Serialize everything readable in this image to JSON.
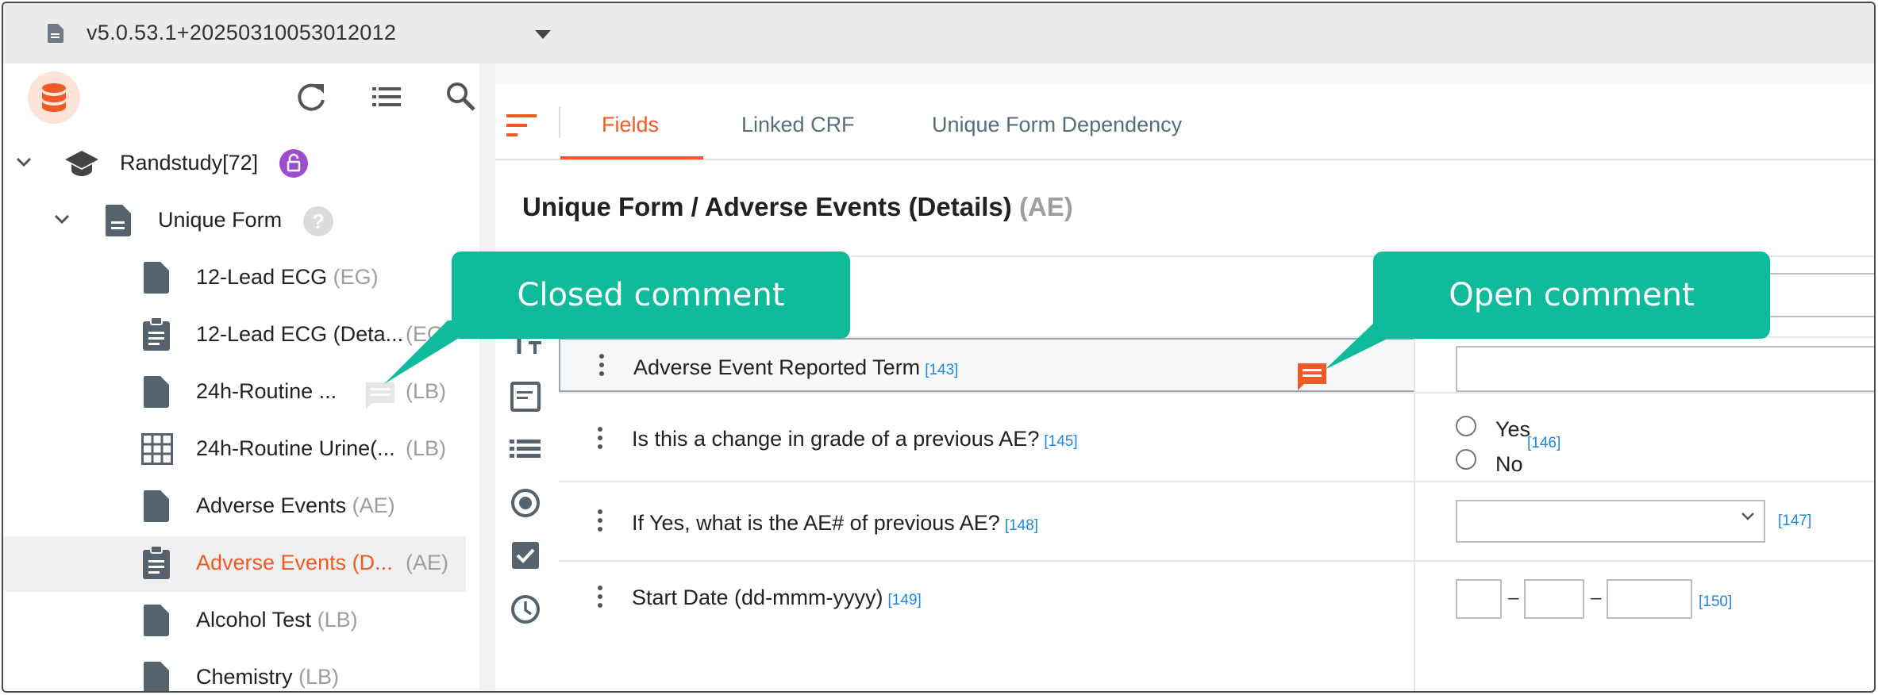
{
  "version_bar": {
    "version": "v5.0.53.1+20250310053012012"
  },
  "sidebar": {
    "study": {
      "label": "Randstudy[72]"
    },
    "group": {
      "label": "Unique Form"
    },
    "items": [
      {
        "label": "12-Lead ECG",
        "code": "(EG)"
      },
      {
        "label": "12-Lead ECG (Deta...",
        "code": "(EG)"
      },
      {
        "label": "24h-Routine ...",
        "code": "(LB)"
      },
      {
        "label": "24h-Routine Urine(...",
        "code": "(LB)"
      },
      {
        "label": "Adverse Events",
        "code": "(AE)"
      },
      {
        "label": "Adverse Events (D...",
        "code": "(AE)"
      },
      {
        "label": "Alcohol Test",
        "code": "(LB)"
      },
      {
        "label": "Chemistry",
        "code": "(LB)"
      }
    ]
  },
  "tabs": [
    {
      "label": "Fields"
    },
    {
      "label": "Linked CRF"
    },
    {
      "label": "Unique Form Dependency"
    }
  ],
  "page": {
    "title": "Unique Form / Adverse Events (Details)",
    "code": "(AE)"
  },
  "fields": [
    {
      "label": "Adverse Event Reported Term",
      "ref": "[143]"
    },
    {
      "label": "Is this a change in grade of a previous AE?",
      "ref": "[145]",
      "options": [
        "Yes",
        "No"
      ],
      "options_ref": "[146]"
    },
    {
      "label": "If Yes, what is the AE# of previous AE?",
      "ref": "[148]",
      "input_ref": "[147]"
    },
    {
      "label": "Start Date (dd-mmm-yyyy)",
      "ref": "[149]",
      "input_ref": "[150]",
      "date_sep": "–"
    }
  ],
  "callouts": {
    "closed": "Closed comment",
    "open": "Open comment"
  },
  "colors": {
    "accent": "#f15a24",
    "callout": "#0fbb9b",
    "link": "#1e88e5",
    "badge": "#9c4dcc"
  }
}
